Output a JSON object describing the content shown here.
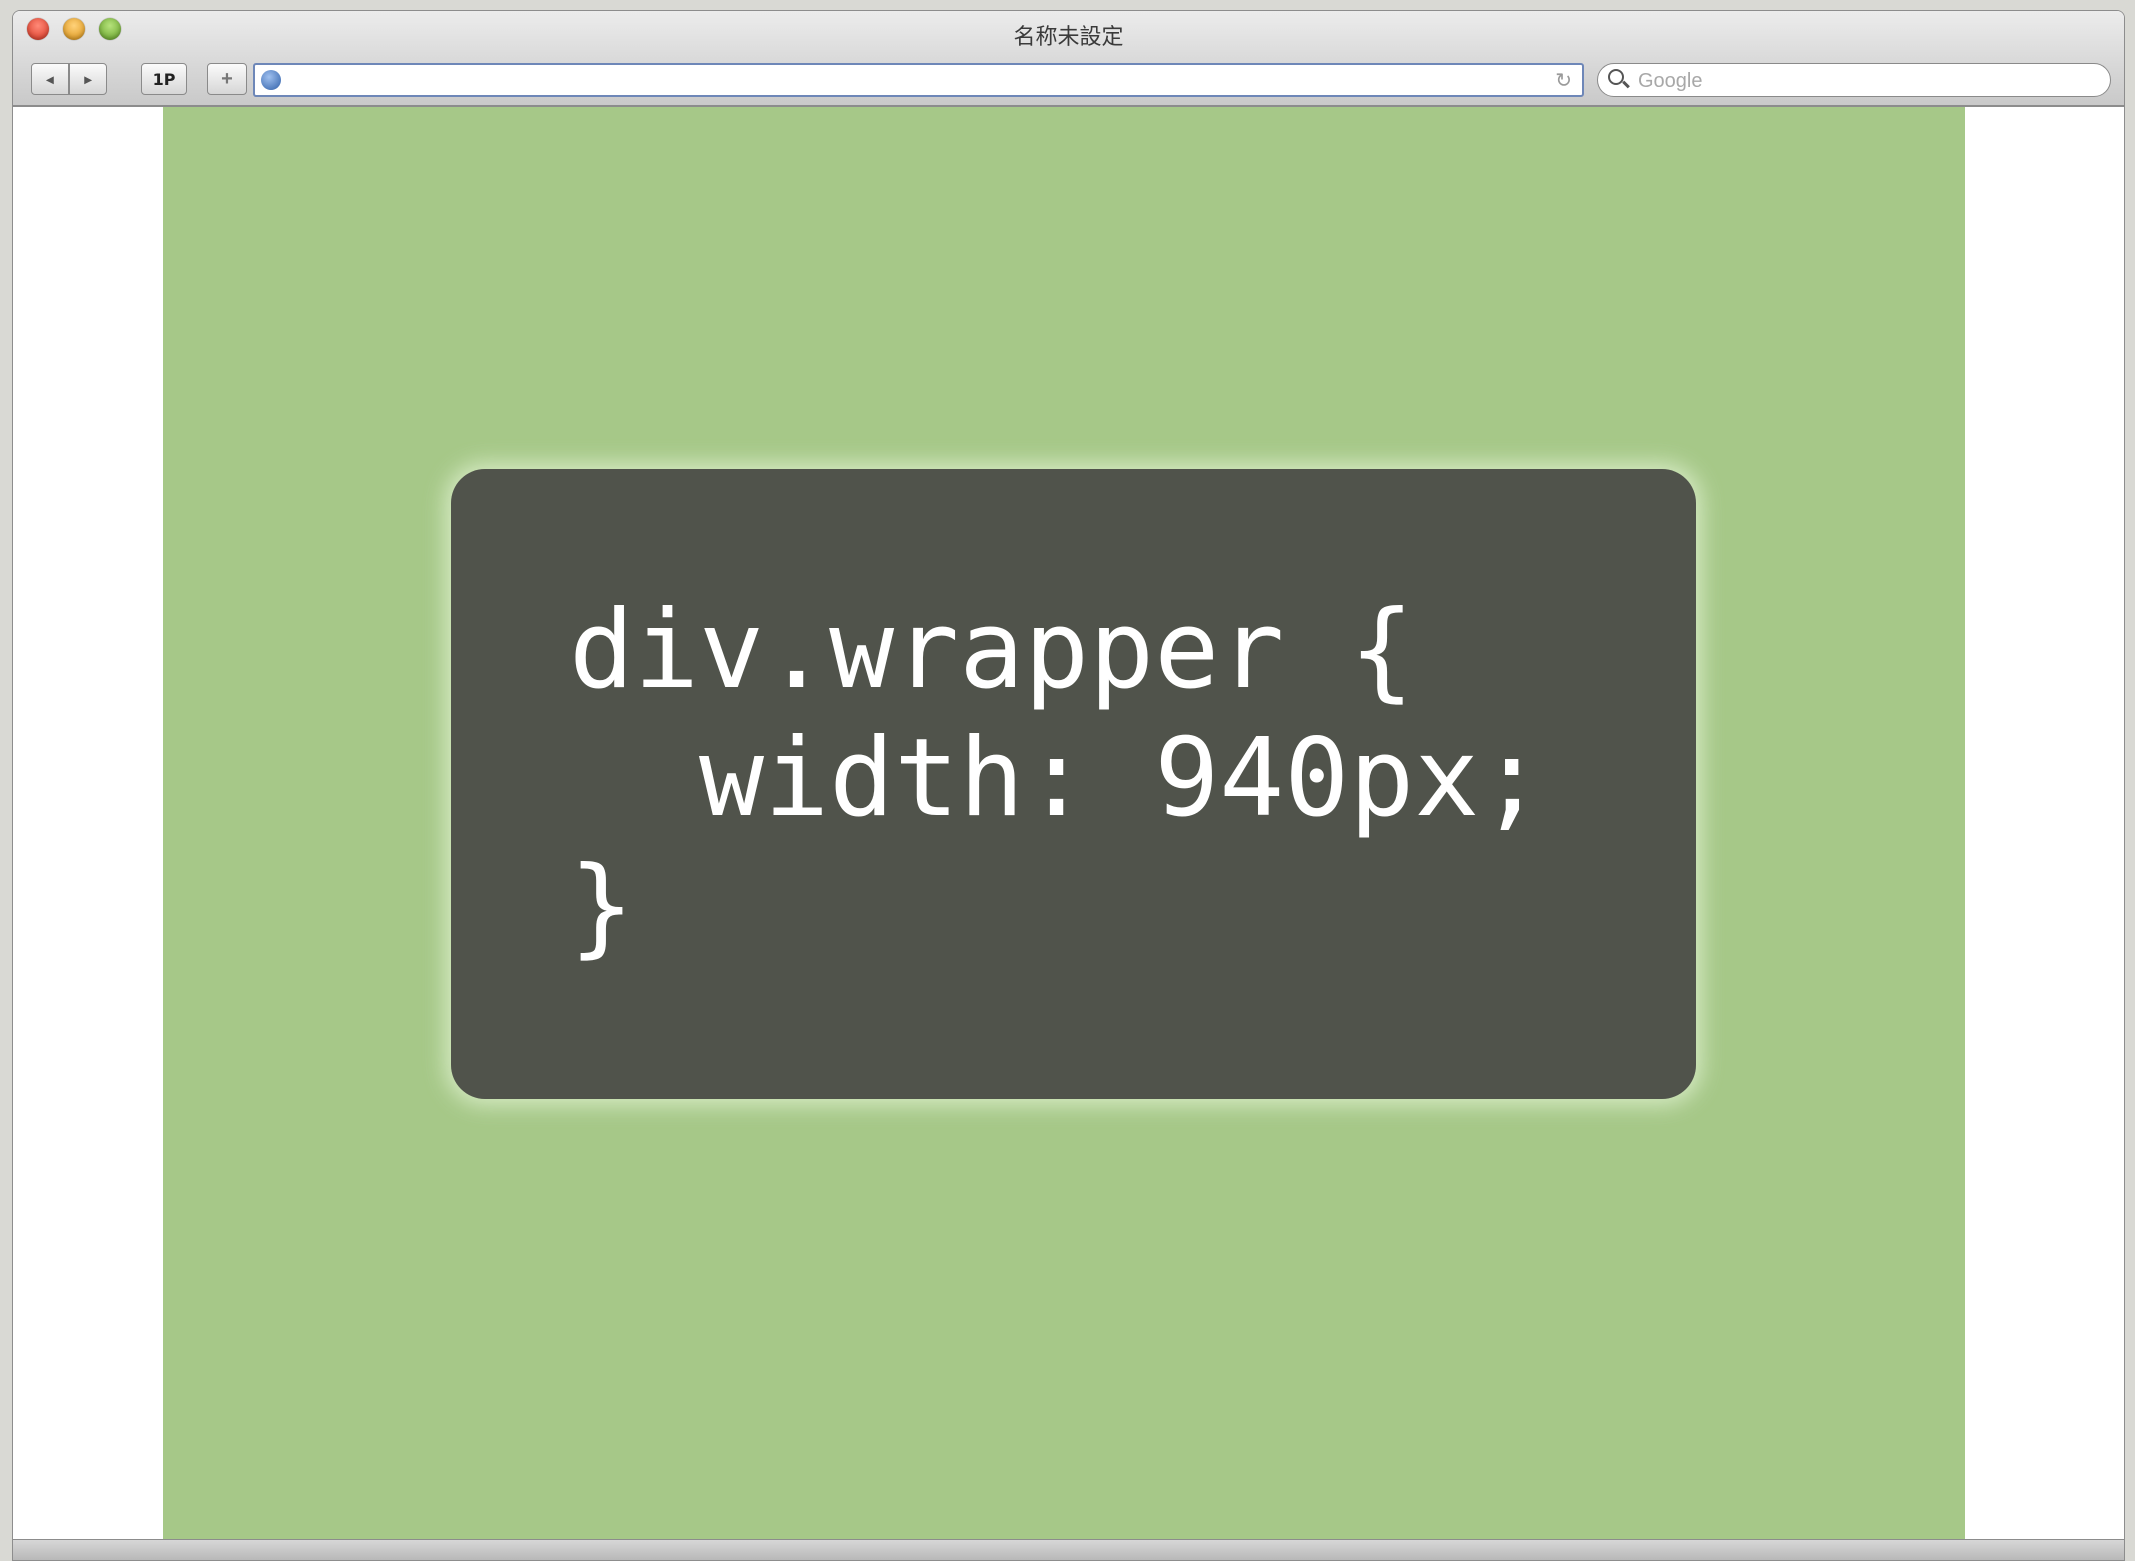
{
  "window": {
    "title": "名称未設定"
  },
  "toolbar": {
    "back_glyph": "◂",
    "forward_glyph": "▸",
    "onepassword_label": "1P",
    "add_bookmark_glyph": "+",
    "reload_glyph": "↻",
    "address_value": "",
    "search_placeholder": "Google"
  },
  "page": {
    "background_color": "#a6c888",
    "code_box_color": "#50534b",
    "code_lines": [
      "div.wrapper {",
      "  width: 940px;",
      "}"
    ]
  },
  "icons": {
    "traffic": [
      "close-icon",
      "minimize-icon",
      "zoom-icon"
    ],
    "address": "globe-icon",
    "reload": "reload-icon",
    "search": "search-icon"
  }
}
